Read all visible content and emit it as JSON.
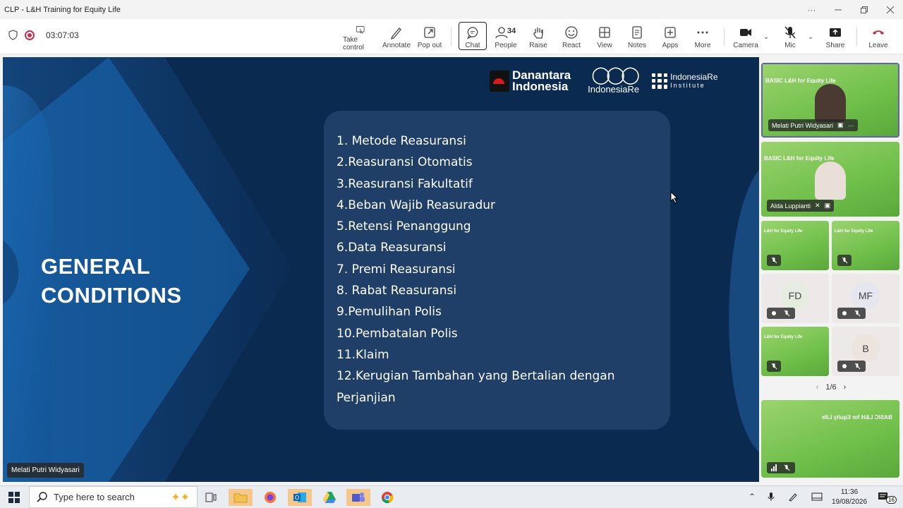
{
  "window": {
    "title": "CLP - L&H Training for Equity Life"
  },
  "toolbar": {
    "timer": "03:07:03",
    "take_control": "Take control",
    "annotate": "Annotate",
    "pop_out": "Pop out",
    "chat": "Chat",
    "people": "People",
    "people_count": "34",
    "raise": "Raise",
    "react": "React",
    "view": "View",
    "notes": "Notes",
    "apps": "Apps",
    "more": "More",
    "camera": "Camera",
    "mic": "Mic",
    "share": "Share",
    "leave": "Leave"
  },
  "slide": {
    "title_line1": "GENERAL",
    "title_line2": "CONDITIONS",
    "logo_danantara_1": "Danantara",
    "logo_danantara_2": "Indonesia",
    "logo_indonesiare": "IndonesiaRe",
    "logo_institute_1": "IndonesiaRe",
    "logo_institute_2": "Institute",
    "items": [
      "1. Metode Reasuransi",
      "2.Reasuransi Otomatis",
      "3.Reasuransi Fakultatif",
      "4.Beban Wajib Reasuradur",
      "5.Retensi Penanggung",
      "6.Data Reasuransi",
      "7. Premi Reasuransi",
      "8. Rabat Reasuransi",
      "9.Pemulihan Polis",
      "10.Pembatalan Polis",
      "11.Klaim",
      "12.Kerugian Tambahan yang Bertalian dengan Perjanjian"
    ],
    "presenter": "Melati Putri Widyasari"
  },
  "participants": {
    "tile_header": "BASIC L&H for Equity Life",
    "tile_header_short": "L&H for Equity Life",
    "p1_name": "Melati Putri Widyasari",
    "p2_name": "Alda Luppianti",
    "fd": "FD",
    "mf": "MF",
    "b": "B",
    "page": "1/6"
  },
  "taskbar": {
    "search_placeholder": "Type here to search",
    "time": "11:36",
    "date": "19/08/2026",
    "notif_count": "16"
  },
  "colors": {
    "slide_bg": "#0a2a50",
    "card_bg": "#1f3f68",
    "tile_green": "#7ec45a",
    "leave_red": "#c4314b"
  }
}
